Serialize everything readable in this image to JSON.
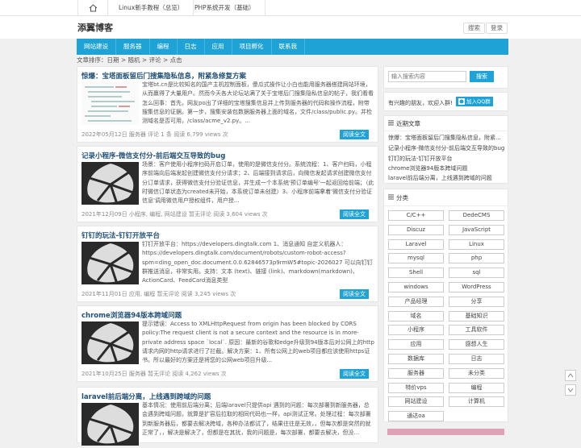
{
  "topbar": {
    "links": [
      "Linux新手教程（总览）",
      "PHP系统开发（基础）"
    ]
  },
  "header": {
    "logo": "添翼博客",
    "search_label": "搜索",
    "login_label": "登录"
  },
  "nav": [
    "网站建设",
    "服务器",
    "编程",
    "日志",
    "应用",
    "项目孵化",
    "联系我"
  ],
  "sortbar": "文章排序：日期 > 随机 > 评论 > 点击",
  "posts": [
    {
      "title": "惊爆：宝塔面板留后门搜集隐私信息，附紧急修复方案",
      "excerpt": "宝塔bt.cn是比较知名的国产主机控制面板，傻瓜式操作让小白也能用服务器搭建网站环境，从而赢得了大量用户。然而今天各大论坛站满了关于宝塔后门搜集隐私信息的帖子，我们看看怎么回事：首先，网友po出了详细的宝塔搜集信息并上传到服务器的代码和操作流程，附带搜集信息的证据。第一步，搜集安装包数据服务器上面的域名，文件/class/public.py。并检测域名是否可用，/class/acme_v2.py。...",
      "meta": "2022年05月12日  服务器  评论 1 条  阅读 6,799 views 次",
      "read": "阅读全文"
    },
    {
      "title": "记录小程序-微信支付分-前后端交互导致的bug",
      "excerpt": "场景：客户使用小程序扫码开启订单，使用的是微信支付分。系统流程：1、客户扫码，小程序前端向后端发起创建微信支付分请求；2、后端接到请求后，向微信发起请求创建微信支付分订单请求，获得微信支付分验证信息，并生成一个本系统'预订单编号'一起返回给前端；（此时微信订单状态为created未开始，本系统订单未创建）3、小程序前端拿着'微信支付分验证信息'调用微信用户授权组件，用户授...",
      "meta": "2021年12月09日  小程序, 编程, 网站建设  暂无评论  阅读 3,604 views 次",
      "read": "阅读全文"
    },
    {
      "title": "钉钉的玩法-钉钉开放平台",
      "excerpt": "钉钉开放平台：https://developers.dingtalk.com 1、消息通知 自定义机器人：https://developers.dingtalk.com/document/robots/custom-robot-access?spm=ding_open_doc.document.0.0.62846573p9rmW5#topic-2026027 可以向钉钉群推送消息，非常实用。支持：文本 (text)、链接 (link)、markdown(markdown)、ActionCard、FeedCard消息类型",
      "meta": "2021年11月01日  应用, 编程  暂无评论  阅读 3,245 views 次",
      "read": "阅读全文"
    },
    {
      "title": "chrome浏览器94版本跨域问题",
      "excerpt": "提示错误：Access to XMLHttpRequest from origin has been blocked by CORS policy:The request client is not a secure context and the resource is in more-private address space `local`. 原因：最新的谷歌和edge升级到94版本后对公网上的http请求内网的http请求进行了拦截。解决方案：1、所有公网上的web项目都应该使用https证书。所以最好的方案还是将您的公网web项目升级...",
      "meta": "2021年10月25日  服务器  暂无评论  阅读 4,262 views 次",
      "read": "阅读全文"
    },
    {
      "title": "laravel前后端分离，上线遇到跨域的问题",
      "excerpt": "基本情况：使用前后端分离；后端laravel只提供api 遇到的问题：每次部署到新服务器，总会遇到跨域问题，就算是扩容后拉取的相同代码也一样，api测试正常。处理过程：每次部署到新服务器后，都要去解决跨域，各种办法都试了，结果往往是无效，，但每次都是突然的就正常了，，解决是解决了，但都是在其扰，我的问题是，每次部署，都要去解决，但没...",
      "meta": "",
      "read": ""
    }
  ],
  "sidebar": {
    "search_placeholder": "输入搜索内容",
    "search_button": "搜索",
    "welcome": "有兴趣的朋友，欢迎入群!",
    "qq_button": "加入QQ群",
    "recent_title": "近期文章",
    "recent": [
      "惊爆：宝塔面板留后门搜集隐私信息，附紧...",
      "记录小程序-微信支付分-前后端交互导致的bug",
      "钉钉的玩法-钉钉开放平台",
      "chrome浏览器94版本跨域问题",
      "laravel前后端分离，上线遇到跨域的问题"
    ],
    "cat_title": "分类",
    "tags": [
      "C/C++",
      "DedeCMS",
      "Discuz",
      "JavaScript",
      "Laravel",
      "Linux",
      "mysql",
      "php",
      "Shell",
      "sql",
      "windows",
      "WordPress",
      "产品经理",
      "分享",
      "域名",
      "基础知识",
      "小程序",
      "工具软件",
      "应用",
      "感想人生",
      "数据库",
      "日志",
      "服务器",
      "未分类",
      "特价vps",
      "编程",
      "网站建设",
      "计算机",
      "通达oa"
    ]
  },
  "colors": {
    "accent": "#1fa3d6",
    "title": "#1f4f77"
  }
}
